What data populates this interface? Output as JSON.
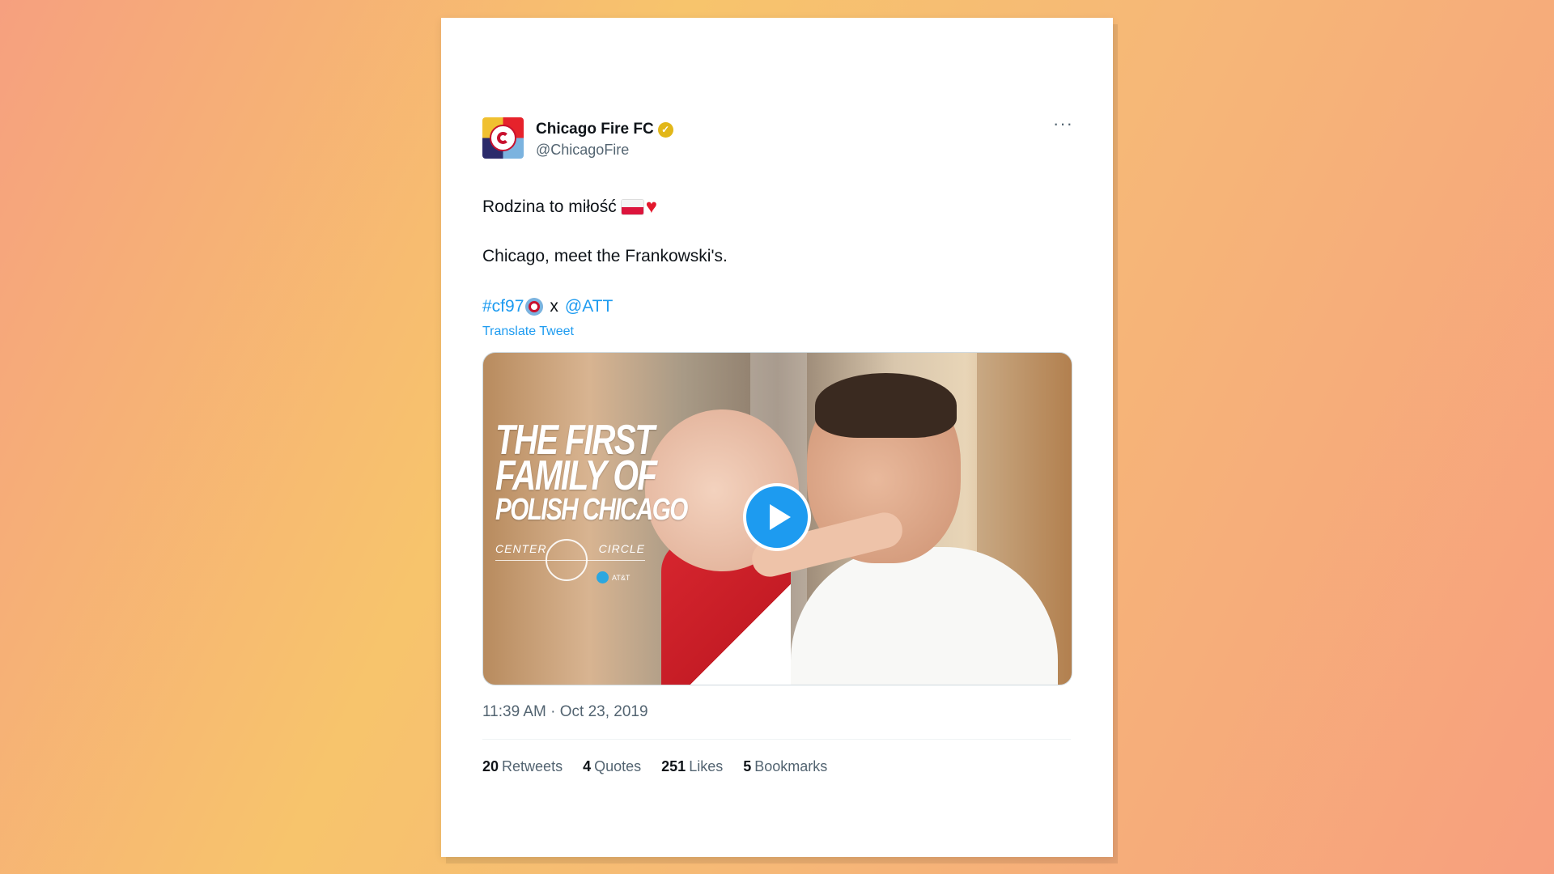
{
  "author": {
    "display_name": "Chicago Fire FC",
    "handle": "@ChicagoFire",
    "verified_color": "#e2b719",
    "avatar_icon": "chicago-fire-crest-icon"
  },
  "more_menu": "···",
  "tweet": {
    "line1": "Rodzina to miłość",
    "line2": "Chicago, meet the Frankowski's.",
    "hashtag": "#cf97",
    "separator": "x",
    "mention": "@ATT",
    "translate_label": "Translate Tweet"
  },
  "media": {
    "title_line1": "THE FIRST",
    "title_line2": "FAMILY OF",
    "title_line3": "POLISH CHICAGO",
    "series_left": "CENTER",
    "series_right": "CIRCLE",
    "sponsor": "AT&T",
    "play_icon": "play-icon"
  },
  "timestamp": "11:39 AM · Oct 23, 2019",
  "stats": {
    "retweets_count": "20",
    "retweets_label": "Retweets",
    "quotes_count": "4",
    "quotes_label": "Quotes",
    "likes_count": "251",
    "likes_label": "Likes",
    "bookmarks_count": "5",
    "bookmarks_label": "Bookmarks"
  },
  "colors": {
    "link": "#1d9bf0",
    "text": "#0f1419",
    "muted": "#536471"
  }
}
